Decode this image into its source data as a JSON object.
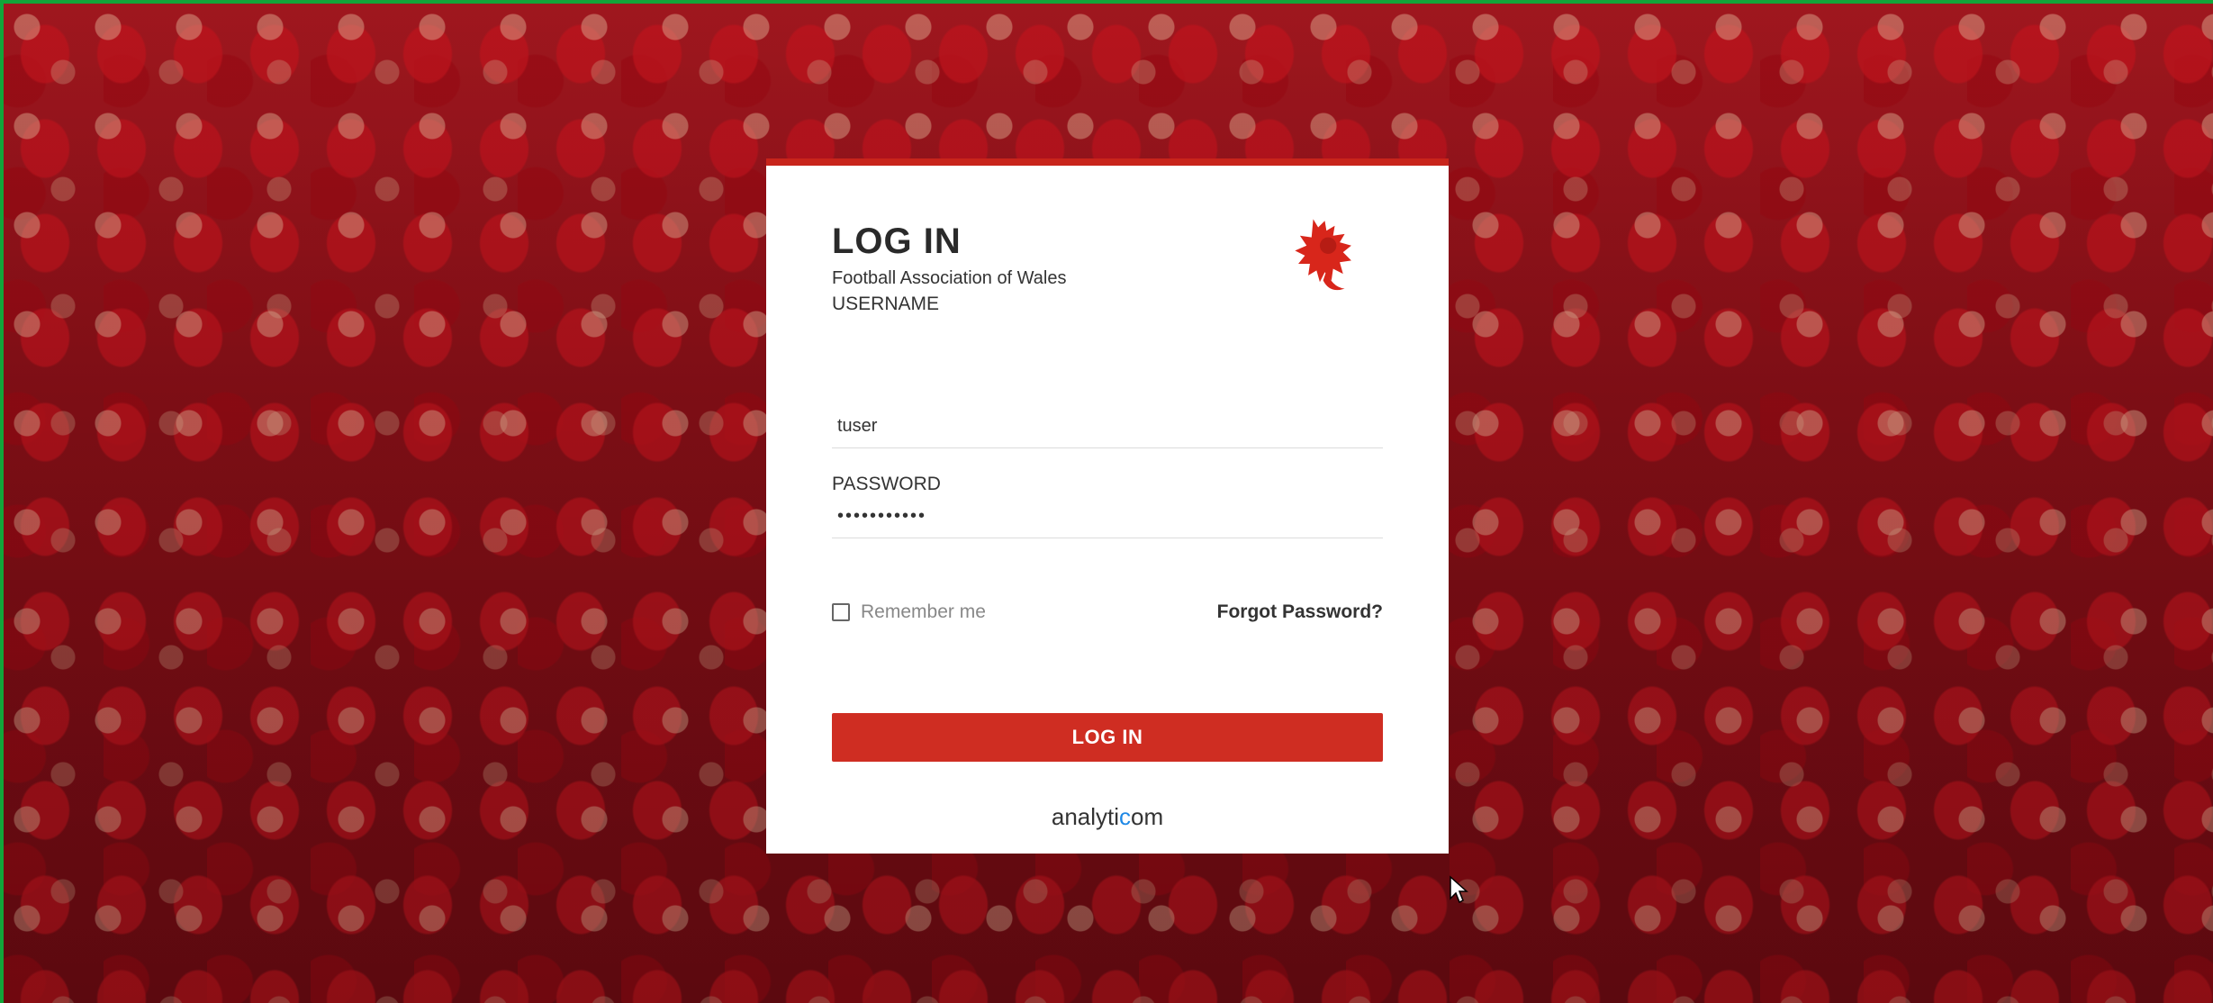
{
  "background": {
    "description_icon": "crowd-photo"
  },
  "card": {
    "title": "LOG IN",
    "subtitle": "Football Association of Wales",
    "logo_icon": "welsh-dragon-icon",
    "username_label": "USERNAME",
    "username_value": "tuser",
    "password_label": "PASSWORD",
    "password_value": "•••••••••••",
    "remember_label": "Remember me",
    "forgot_label": "Forgot Password?",
    "login_button": "LOG IN",
    "brand_prefix": "analyti",
    "brand_accent": "c",
    "brand_suffix": "om"
  },
  "colors": {
    "accent": "#cf2d22",
    "frame": "#12a53a",
    "brand_accent": "#1e88e5"
  }
}
